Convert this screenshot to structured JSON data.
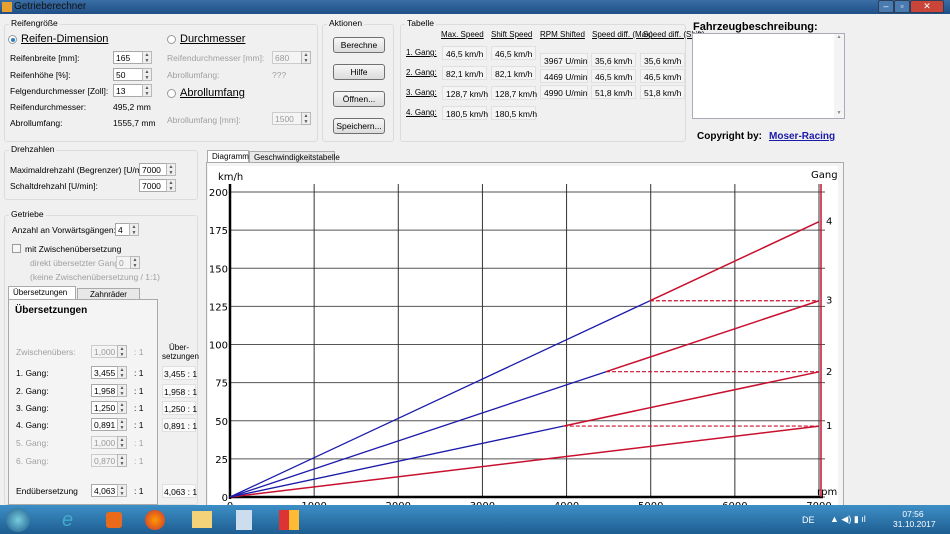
{
  "window": {
    "title": "Getrieberechner"
  },
  "reifen": {
    "group": "Reifengröße",
    "opt_dimension": "Reifen-Dimension",
    "opt_durchmesser": "Durchmesser",
    "opt_abroll": "Abrollumfang",
    "breite_label": "Reifenbreite [mm]:",
    "breite": "165",
    "hoehe_label": "Reifenhöhe [%]:",
    "hoehe": "50",
    "felge_label": "Felgendurchmesser [Zoll]:",
    "felge": "13",
    "rd_label": "Reifendurchmesser:",
    "rd_value": "495,2 mm",
    "au_label": "Abrollumfang:",
    "au_value": "1555,7 mm",
    "d_label": "Reifendurchmesser [mm]:",
    "d_value": "680",
    "d_au_label": "Abrollumfang:",
    "d_au_value": "???",
    "abroll_label": "Abrollumfang [mm]:",
    "abroll_value": "1500"
  },
  "aktionen": {
    "group": "Aktionen",
    "berechne": "Berechne",
    "hilfe": "Hilfe",
    "oeffnen": "Öffnen...",
    "speichern": "Speichern..."
  },
  "tabelle": {
    "group": "Tabelle",
    "headers": [
      "Max. Speed",
      "Shift Speed",
      "RPM Shifted",
      "Speed diff. (Max)",
      "Speed diff. (Shift)"
    ],
    "rows": [
      {
        "gang": "1. Gang:",
        "max": "46,5 km/h",
        "shift": "46,5 km/h"
      },
      {
        "gang": "2. Gang:",
        "max": "82,1 km/h",
        "shift": "82,1 km/h"
      },
      {
        "gang": "3. Gang:",
        "max": "128,7 km/h",
        "shift": "128,7 km/h"
      },
      {
        "gang": "4. Gang:",
        "max": "180,5 km/h",
        "shift": "180,5 km/h"
      }
    ],
    "shifts": [
      {
        "rpm": "3967 U/min",
        "dmax": "35,6 km/h",
        "dshift": "35,6 km/h"
      },
      {
        "rpm": "4469 U/min",
        "dmax": "46,5 km/h",
        "dshift": "46,5 km/h"
      },
      {
        "rpm": "4990 U/min",
        "dmax": "51,8 km/h",
        "dshift": "51,8 km/h"
      }
    ]
  },
  "beschreibung": {
    "label": "Fahrzeugbeschreibung:",
    "value": ""
  },
  "copyright": {
    "label": "Copyright by:",
    "link": "Moser-Racing"
  },
  "drehzahlen": {
    "group": "Drehzahlen",
    "max_label": "Maximaldrehzahl (Begrenzer) [U/min]:",
    "max": "7000",
    "schalt_label": "Schaltdrehzahl [U/min]:",
    "schalt": "7000"
  },
  "getriebe": {
    "group": "Getriebe",
    "anzahl_label": "Anzahl an Vorwärtsgängen:",
    "anzahl": "4",
    "zw_check": "mit Zwischenübersetzung",
    "direkt_label": "direkt übersetzter Gang:",
    "direkt": "0",
    "hint": "(keine Zwischenübersetzung / 1:1)",
    "tabs": [
      "Übersetzungen",
      "Zahnräder"
    ],
    "heading": "Übersetzungen",
    "col_head": "Über-setzungen",
    "ratio_suffix": ": 1",
    "rows": [
      {
        "label": "Zwischenübers:",
        "value": "1,000",
        "result": "",
        "enabled": false
      },
      {
        "label": "1. Gang:",
        "value": "3,455",
        "result": "3,455 : 1",
        "enabled": true
      },
      {
        "label": "2. Gang:",
        "value": "1,958",
        "result": "1,958 : 1",
        "enabled": true
      },
      {
        "label": "3. Gang:",
        "value": "1,250",
        "result": "1,250 : 1",
        "enabled": true
      },
      {
        "label": "4. Gang:",
        "value": "0,891",
        "result": "0,891 : 1",
        "enabled": true
      },
      {
        "label": "5. Gang:",
        "value": "1,000",
        "result": "",
        "enabled": false
      },
      {
        "label": "6. Gang:",
        "value": "0,870",
        "result": "",
        "enabled": false
      },
      {
        "label": "Endübersetzung",
        "value": "4,063",
        "result": "4,063 : 1",
        "enabled": true
      }
    ]
  },
  "chart_tabs": [
    "Diagramm",
    "Geschwindigkeitstabelle"
  ],
  "chart_data": {
    "type": "line",
    "ylabel": "km/h",
    "xlabel": "rpm",
    "right_label": "Gang",
    "xlim": [
      0,
      7000
    ],
    "ylim": [
      0,
      200
    ],
    "xticks": [
      0,
      1000,
      2000,
      3000,
      4000,
      5000,
      6000,
      7000
    ],
    "yticks": [
      0,
      25,
      50,
      75,
      100,
      125,
      150,
      175,
      200
    ],
    "grid": true,
    "gears": [
      {
        "name": "1",
        "max_speed": 46.5,
        "shift_from_rpm": 0
      },
      {
        "name": "2",
        "max_speed": 82.1,
        "shift_from_rpm": 3967
      },
      {
        "name": "3",
        "max_speed": 128.7,
        "shift_from_rpm": 4469
      },
      {
        "name": "4",
        "max_speed": 180.5,
        "shift_from_rpm": 4990
      }
    ],
    "colors": {
      "below_shift": "#1a1aaa",
      "above_shift": "#c8102e"
    }
  },
  "taskbar": {
    "lang": "DE",
    "time": "07:56",
    "date": "31.10.2017"
  }
}
